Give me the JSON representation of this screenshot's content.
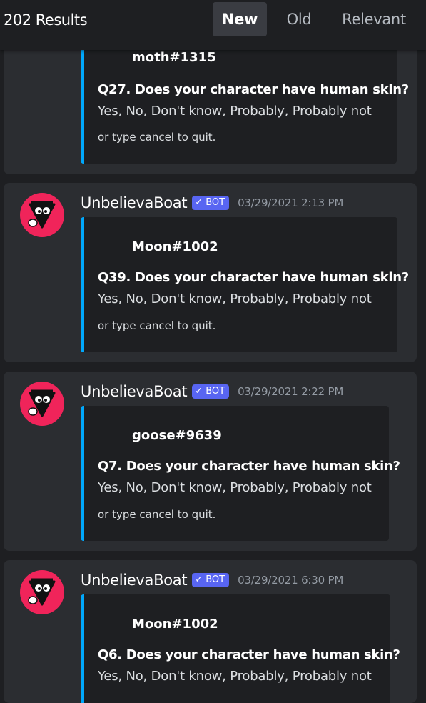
{
  "header": {
    "results_count": "202 Results",
    "tabs": [
      {
        "label": "New",
        "active": true
      },
      {
        "label": "Old",
        "active": false
      },
      {
        "label": "Relevant",
        "active": false
      }
    ]
  },
  "results": [
    {
      "author": "",
      "bot_tag": "",
      "timestamp": "",
      "embed": {
        "author": "moth#1315",
        "title": "Q27. Does your character have human skin?",
        "description": "Yes, No, Don't know, Probably, Probably not",
        "footer": "or type cancel to quit."
      }
    },
    {
      "author": "UnbelievaBoat",
      "bot_tag": "BOT",
      "timestamp": "03/29/2021 2:13 PM",
      "embed": {
        "author": "Moon#1002",
        "title": "Q39. Does your character have human skin?",
        "description": "Yes, No, Don't know, Probably, Probably not",
        "footer": "or type cancel to quit."
      }
    },
    {
      "author": "UnbelievaBoat",
      "bot_tag": "BOT",
      "timestamp": "03/29/2021 2:22 PM",
      "embed": {
        "author": "goose#9639",
        "title": "Q7. Does your character have human skin?",
        "description": "Yes, No, Don't know, Probably, Probably not",
        "footer": "or type cancel to quit."
      }
    },
    {
      "author": "UnbelievaBoat",
      "bot_tag": "BOT",
      "timestamp": "03/29/2021 6:30 PM",
      "embed": {
        "author": "Moon#1002",
        "title": "Q6. Does your character have human skin?",
        "description": "Yes, No, Don't know, Probably, Probably not",
        "footer": ""
      }
    }
  ],
  "colors": {
    "background": "#1e1f22",
    "card": "#2b2d31",
    "embed_border": "#00a8fc",
    "bot_tag": "#5865f2",
    "avatar_bg": "#f0245a"
  }
}
